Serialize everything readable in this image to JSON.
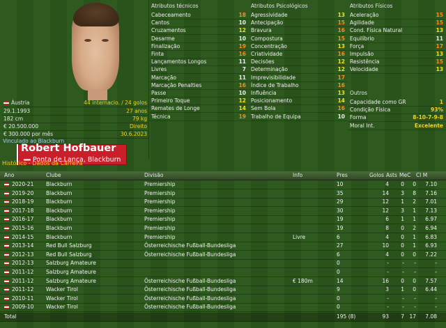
{
  "player": {
    "name": "Robert Hofbauer",
    "position": "Ponta de Lança, Blackburn",
    "info": [
      {
        "left": "Áustria",
        "right": "44 internacio. / 24 golos"
      },
      {
        "left": "29.1.1993",
        "right": "27 anos"
      },
      {
        "left": "182 cm",
        "right": "79 kg"
      },
      {
        "left": "€ 20.500.000",
        "right": "Direito"
      },
      {
        "left": "€ 300.000 por mês",
        "right": "30.6.2023"
      }
    ],
    "contract_note": "Vinculado ao Blackburn"
  },
  "attributes": {
    "tecnicos": {
      "title": "Atributos técnicos",
      "rows": [
        {
          "label": "Cabeceamento",
          "value": "18",
          "color": "orange"
        },
        {
          "label": "Cantos",
          "value": "10",
          "color": "plain"
        },
        {
          "label": "Cruzamentos",
          "value": "12",
          "color": "yellow"
        },
        {
          "label": "Desarme",
          "value": "10",
          "color": "plain"
        },
        {
          "label": "Finalização",
          "value": "19",
          "color": "orange"
        },
        {
          "label": "Finta",
          "value": "16",
          "color": "orange"
        },
        {
          "label": "Lançamentos Longos",
          "value": "11",
          "color": "plain"
        },
        {
          "label": "Livres",
          "value": "7",
          "color": "plain"
        },
        {
          "label": "Marcação",
          "value": "11",
          "color": "plain"
        },
        {
          "label": "Marcação Penalties",
          "value": "16",
          "color": "orange"
        },
        {
          "label": "Passe",
          "value": "10",
          "color": "plain"
        },
        {
          "label": "Primeiro Toque",
          "value": "12",
          "color": "yellow"
        },
        {
          "label": "Remates de Longe",
          "value": "14",
          "color": "yellow"
        },
        {
          "label": "Técnica",
          "value": "19",
          "color": "orange"
        }
      ]
    },
    "psicologicos": {
      "title": "Atributos Psicológicos",
      "rows": [
        {
          "label": "Agressividade",
          "value": "13",
          "color": "yellow"
        },
        {
          "label": "Antecipação",
          "value": "15",
          "color": "orange"
        },
        {
          "label": "Bravura",
          "value": "16",
          "color": "orange"
        },
        {
          "label": "Compostura",
          "value": "15",
          "color": "orange"
        },
        {
          "label": "Concentração",
          "value": "13",
          "color": "yellow"
        },
        {
          "label": "Criatividade",
          "value": "16",
          "color": "orange"
        },
        {
          "label": "Decisões",
          "value": "12",
          "color": "yellow"
        },
        {
          "label": "Determinação",
          "value": "12",
          "color": "yellow"
        },
        {
          "label": "Imprevisibilidade",
          "value": "17",
          "color": "orange"
        },
        {
          "label": "Índice de Trabalho",
          "value": "16",
          "color": "orange"
        },
        {
          "label": "Influência",
          "value": "13",
          "color": "yellow"
        },
        {
          "label": "Posicionamento",
          "value": "14",
          "color": "yellow"
        },
        {
          "label": "Sem Bola",
          "value": "16",
          "color": "orange"
        },
        {
          "label": "Trabalho de Equipa",
          "value": "10",
          "color": "plain"
        }
      ]
    },
    "fisicos": {
      "title": "Atributos Físicos",
      "rows": [
        {
          "label": "Aceleração",
          "value": "15",
          "color": "orange"
        },
        {
          "label": "Agilidade",
          "value": "15",
          "color": "orange"
        },
        {
          "label": "Cond. Física Natural",
          "value": "13",
          "color": "yellow"
        },
        {
          "label": "Equilíbrio",
          "value": "11",
          "color": "plain"
        },
        {
          "label": "Força",
          "value": "17",
          "color": "orange"
        },
        {
          "label": "Impulsão",
          "value": "13",
          "color": "yellow"
        },
        {
          "label": "Resistência",
          "value": "15",
          "color": "orange"
        },
        {
          "label": "Velocidade",
          "value": "13",
          "color": "yellow"
        }
      ]
    },
    "outros": {
      "title": "Outros",
      "rows": [
        {
          "label": "Capacidade como GR",
          "value": "1"
        },
        {
          "label": "Condição Física",
          "value": "93%"
        },
        {
          "label": "Forma",
          "value": "8-10-7-9-8"
        },
        {
          "label": "Moral Int.",
          "value": "Excelente"
        }
      ]
    }
  },
  "history": {
    "title": "Histórico - Dados da Carreira",
    "columns": [
      "Ano",
      "Clube",
      "Divisão",
      "Info",
      "Pres",
      "Golos",
      "Asts",
      "MeC",
      "Cl M"
    ],
    "rows": [
      [
        "2020-21",
        "Blackburn",
        "Premiership",
        "",
        "10",
        "4",
        "0",
        "0",
        "7.10"
      ],
      [
        "2019-20",
        "Blackburn",
        "Premiership",
        "",
        "35",
        "14",
        "3",
        "8",
        "7.16"
      ],
      [
        "2018-19",
        "Blackburn",
        "Premiership",
        "",
        "29",
        "12",
        "1",
        "2",
        "7.01"
      ],
      [
        "2017-18",
        "Blackburn",
        "Premiership",
        "",
        "30",
        "12",
        "3",
        "1",
        "7.13"
      ],
      [
        "2016-17",
        "Blackburn",
        "Premiership",
        "",
        "19",
        "6",
        "1",
        "1",
        "6.97"
      ],
      [
        "2015-16",
        "Blackburn",
        "Premiership",
        "",
        "19",
        "8",
        "0",
        "2",
        "6.94"
      ],
      [
        "2014-15",
        "Blackburn",
        "Premiership",
        "Livre",
        "6",
        "4",
        "0",
        "1",
        "6.83"
      ],
      [
        "2013-14",
        "Red Bull Salzburg",
        "Österreichische Fußball-Bundesliga",
        "",
        "27",
        "10",
        "0",
        "1",
        "6.93"
      ],
      [
        "2012-13",
        "Red Bull Salzburg",
        "Österreichische Fußball-Bundesliga",
        "",
        "6",
        "4",
        "0",
        "0",
        "7.22"
      ],
      [
        "2012-13",
        "Salzburg Amateure",
        "",
        "",
        "0",
        "-",
        "-",
        "-",
        "-"
      ],
      [
        "2011-12",
        "Salzburg Amateure",
        "",
        "",
        "0",
        "-",
        "-",
        "-",
        "-"
      ],
      [
        "2011-12",
        "Salzburg Amateure",
        "Österreichische Fußball-Bundesliga",
        "€ 180m",
        "14",
        "16",
        "0",
        "0",
        "7.57"
      ],
      [
        "2011-12",
        "Wacker Tirol",
        "Österreichische Fußball-Bundesliga",
        "",
        "9",
        "3",
        "1",
        "0",
        "6.44"
      ],
      [
        "2010-11",
        "Wacker Tirol",
        "Österreichische Fußball-Bundesliga",
        "",
        "0",
        "-",
        "-",
        "-",
        "-"
      ],
      [
        "2009-10",
        "Wacker Tirol",
        "Österreichische Fußball-Bundesliga",
        "",
        "0",
        "-",
        "-",
        "-",
        "-"
      ]
    ],
    "total": {
      "label": "Total",
      "pres": "195 (8)",
      "golos": "93",
      "asts": "7",
      "mec": "17",
      "clm": "7.08"
    }
  },
  "colors": {
    "orange": "#ff8c1a",
    "yellow": "#f3e21b",
    "accent_red": "#c81f2a"
  }
}
